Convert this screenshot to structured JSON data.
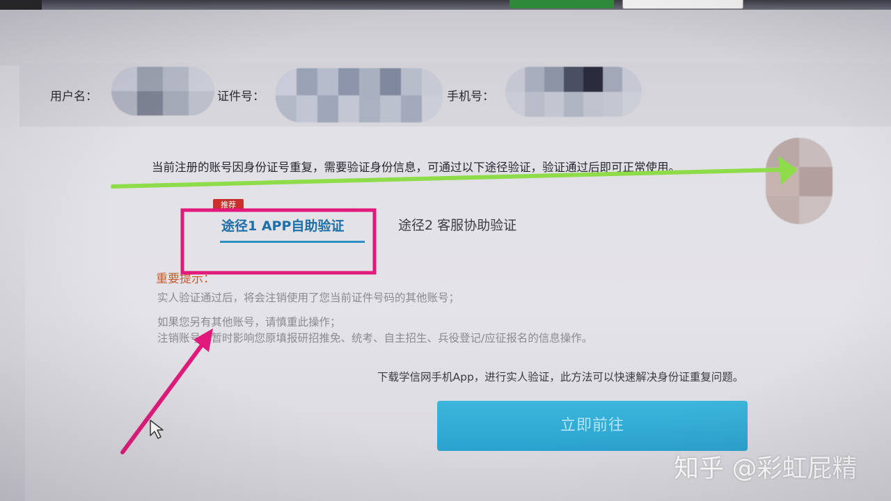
{
  "info": {
    "username_label": "用户名：",
    "id_label": "证件号：",
    "phone_label": "手机号："
  },
  "notice": "当前注册的账号因身份证号重复，需要验证身份信息，可通过以下途径验证，验证通过后即可正常使用。",
  "tabs": [
    {
      "label": "途径1 APP自助验证",
      "badge": "推荐",
      "active": true
    },
    {
      "label": "途径2 客服协助验证",
      "active": false
    }
  ],
  "tips": {
    "title": "重要提示：",
    "lines": [
      "实人验证通过后，将会注销使用了您当前证件号码的其他账号；",
      "如果您另有其他账号，请慎重此操作；",
      "注销账号会暂时影响您原填报研招推免、统考、自主招生、兵役登记/应征报名的信息操作。"
    ]
  },
  "download_text": "下载学信网手机App，进行实人验证，此方法可以快速解决身份证重复问题。",
  "go_button": "立即前往",
  "watermark": "知乎 @彩虹屁精",
  "colors": {
    "annotation_green": "#8fdc4a",
    "annotation_pink": "#e0197a",
    "tab_active": "#1d6fa8",
    "button": "#2aa3cf",
    "badge": "#c9302c"
  }
}
